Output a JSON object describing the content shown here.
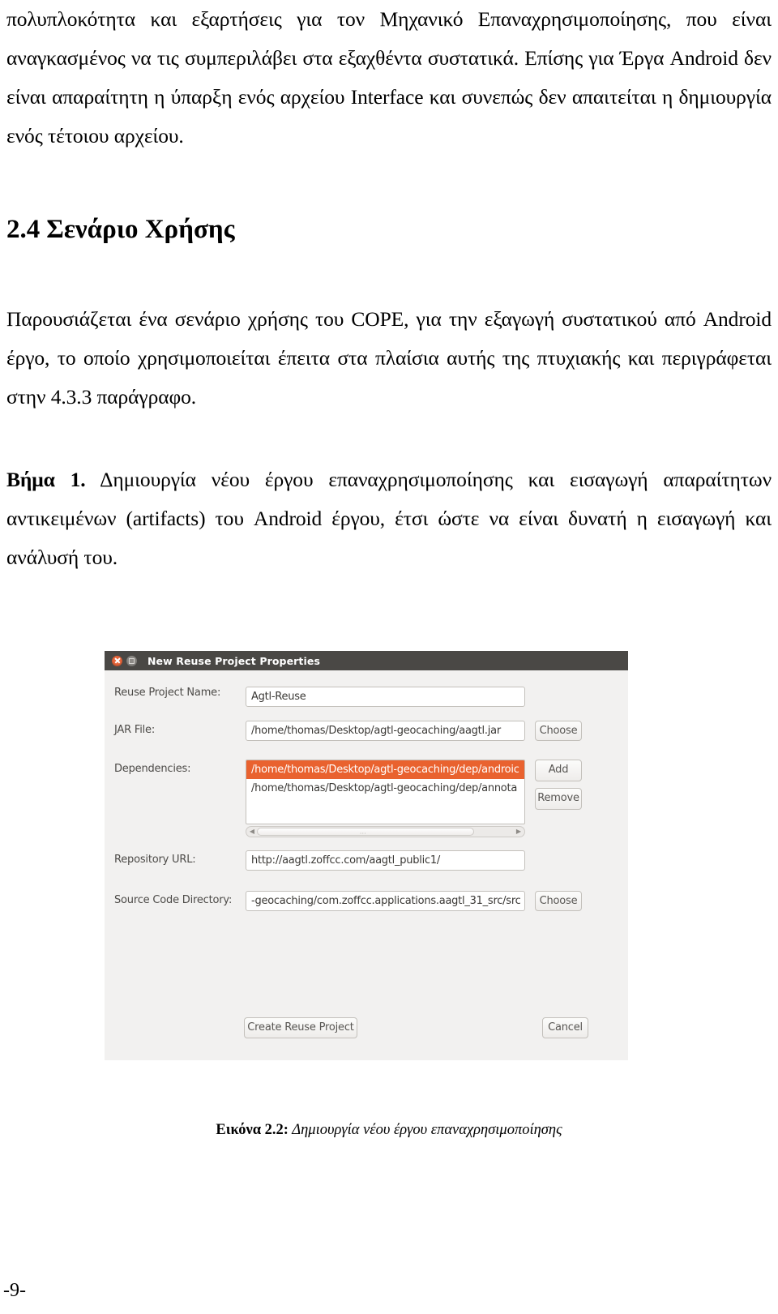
{
  "document": {
    "page_number": "-9-",
    "paragraphs": {
      "intro": "πολυπλοκότητα και εξαρτήσεις για τον Μηχανικό Επαναχρησιμοποίησης, που είναι αναγκασμένος να τις συμπεριλάβει στα εξαχθέντα συστατικά. Επίσης για Έργα Android δεν είναι απαραίτητη η ύπαρξη ενός αρχείου Interface και συνεπώς δεν απαιτείται η δημιουργία ενός τέτοιου αρχείου.",
      "usage": "Παρουσιάζεται ένα σενάριο χρήσης του COPE, για την εξαγωγή συστατικού από Android έργο, το οποίο χρησιμοποιείται έπειτα στα πλαίσια αυτής της πτυχιακής και περιγράφεται στην 4.3.3 παράγραφο.",
      "step_label": "Βήμα 1.",
      "step_text": " Δημιουργία νέου έργου επαναχρησιμοποίησης και εισαγωγή απαραίτητων αντικειμένων (artifacts) του Android έργου, έτσι ώστε να είναι δυνατή η εισαγωγή και ανάλυσή του."
    },
    "section": {
      "number": "2.4",
      "title": "Σενάριο Χρήσης"
    },
    "figure_caption": {
      "label": "Εικόνα 2.2:",
      "text": " Δημιουργία νέου έργου επαναχρησιμοποίησης"
    }
  },
  "dialog": {
    "title": "New Reuse Project Properties",
    "titlebar_color": "#4a4845",
    "background_color": "#f2f1f0",
    "accent_color": "#e9622f",
    "close_icon": "close-icon",
    "minimize_icon": "minimize-icon",
    "fields": {
      "project_name": {
        "label": "Reuse Project Name:",
        "value": "Agtl-Reuse"
      },
      "jar_file": {
        "label": "JAR File:",
        "value": "/home/thomas/Desktop/agtl-geocaching/aagtl.jar",
        "button": "Choose"
      },
      "dependencies": {
        "label": "Dependencies:",
        "items": [
          "/home/thomas/Desktop/agtl-geocaching/dep/androic",
          "/home/thomas/Desktop/agtl-geocaching/dep/annota"
        ],
        "selected_index": 0,
        "add_button": "Add",
        "remove_button": "Remove"
      },
      "repository_url": {
        "label": "Repository URL:",
        "value": "http://aagtl.zoffcc.com/aagtl_public1/"
      },
      "source_code_directory": {
        "label": "Source Code Directory:",
        "value": "-geocaching/com.zoffcc.applications.aagtl_31_src/src",
        "button": "Choose"
      }
    },
    "actions": {
      "create": "Create Reuse Project",
      "cancel": "Cancel"
    }
  }
}
